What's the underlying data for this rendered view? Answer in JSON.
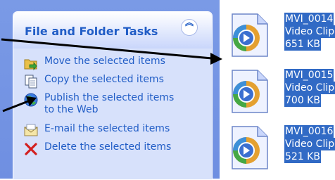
{
  "task_pane": {
    "title": "File and Folder Tasks",
    "collapse_glyph": "︽",
    "tasks": [
      {
        "label": "Move the selected items",
        "icon": "move-folder-icon"
      },
      {
        "label": "Copy the selected items",
        "icon": "copy-document-icon"
      },
      {
        "label": "Publish the selected items to the Web",
        "icon": "globe-publish-icon"
      },
      {
        "label": "E-mail the selected items",
        "icon": "email-envelope-icon"
      },
      {
        "label": "Delete the selected items",
        "icon": "delete-x-icon"
      }
    ]
  },
  "files": [
    {
      "name": "MVI_0014",
      "type": "Video Clip",
      "size": "651 KB",
      "icon": "video-clip-icon"
    },
    {
      "name": "MVI_0015",
      "type": "Video Clip",
      "size": "700 KB",
      "icon": "video-clip-icon"
    },
    {
      "name": "MVI_0016",
      "type": "Video Clip",
      "size": "521 KB",
      "icon": "video-clip-icon"
    }
  ],
  "colors": {
    "pane_background": "#7a9ae6",
    "panel_background": "#d7e1fb",
    "link_blue": "#215dc6",
    "selection_blue": "#316ac5",
    "arrow": "#000000"
  }
}
